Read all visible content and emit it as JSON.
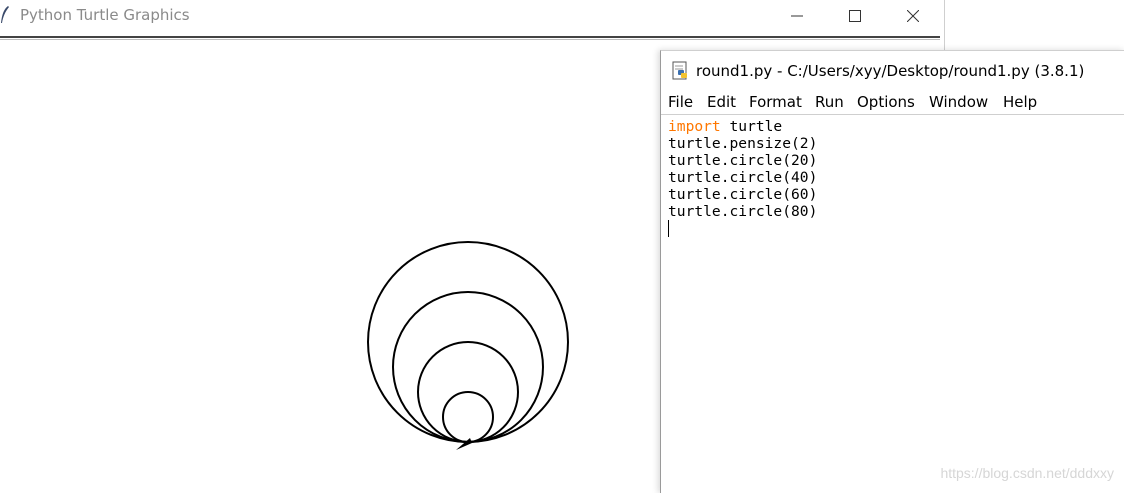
{
  "turtle_window": {
    "title": "Python Turtle Graphics",
    "icons": [
      "feather-icon",
      "minimize-icon",
      "maximize-icon",
      "close-icon"
    ],
    "radii": [
      20,
      40,
      60,
      80
    ],
    "pensize": 2
  },
  "idle_window": {
    "title": "round1.py - C:/Users/xyy/Desktop/round1.py (3.8.1)",
    "menu": [
      "File",
      "Edit",
      "Format",
      "Run",
      "Options",
      "Window",
      "Help"
    ],
    "code": {
      "keyword": "import",
      "line1_rest": " turtle",
      "lines": [
        "turtle.pensize(2)",
        "turtle.circle(20)",
        "turtle.circle(40)",
        "turtle.circle(60)",
        "turtle.circle(80)"
      ]
    },
    "colors": {
      "keyword": "#ff7700",
      "text": "#000000"
    }
  },
  "watermark": "https://blog.csdn.net/dddxxy"
}
